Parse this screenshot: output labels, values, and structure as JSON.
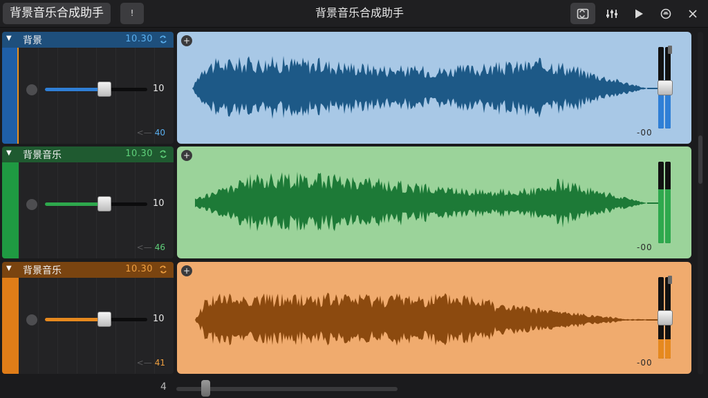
{
  "window": {
    "app_button_label": "背景音乐合成助手",
    "info_button_label": "!",
    "title": "背景音乐合成助手",
    "toolbar_icons": [
      "loop-browser-icon",
      "mixer-icon",
      "play-icon",
      "smart-controls-icon",
      "close-icon"
    ]
  },
  "tracks": [
    {
      "name": "背景",
      "time": "10.30",
      "volume": "10",
      "volume_level": 0.58,
      "pan": "40",
      "db": "-00",
      "meter_level": 0.48,
      "fader_level": 0.5,
      "colors": {
        "band": "#1e4f7c",
        "strip": "#1f5fa8",
        "line": "#e89020",
        "time": "#5ab0f0",
        "region": "#a8c8e6",
        "wave": "#1d5987",
        "meter": "#2f7fd6"
      }
    },
    {
      "name": "背景音乐",
      "time": "10.30",
      "volume": "10",
      "volume_level": 0.58,
      "pan": "46",
      "db": "-00",
      "meter_level": 0.66,
      "fader_level": 0.0,
      "colors": {
        "band": "#1f5a30",
        "strip": "#1f9a42",
        "line": "#1f9a42",
        "time": "#5fd07a",
        "region": "#9bd39a",
        "wave": "#1d7a37",
        "meter": "#2ea84d"
      }
    },
    {
      "name": "背景音乐",
      "time": "10.30",
      "volume": "10",
      "volume_level": 0.58,
      "pan": "41",
      "db": "-00",
      "meter_level": 0.24,
      "fader_level": 0.5,
      "colors": {
        "band": "#7a4410",
        "strip": "#e07d18",
        "line": "#e07d18",
        "time": "#f0a040",
        "region": "#f0ab6e",
        "wave": "#8c4a0f",
        "meter": "#e6891e"
      }
    }
  ],
  "footer": {
    "zoom_value": "4",
    "zoom_level": 0.12
  }
}
